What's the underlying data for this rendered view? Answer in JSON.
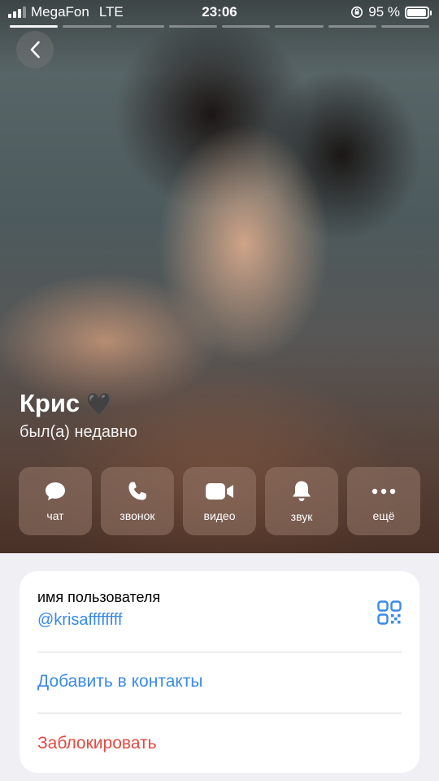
{
  "status_bar": {
    "carrier": "MegaFon",
    "network": "LTE",
    "time": "23:06",
    "battery_text": "95 %",
    "battery_level": 0.95
  },
  "story_progress": {
    "segments": 8,
    "active_index": 0
  },
  "profile": {
    "name": "Крис",
    "name_emoji": "🖤",
    "last_seen": "был(а) недавно"
  },
  "actions": [
    {
      "icon": "chat-bubble-icon",
      "label": "чат"
    },
    {
      "icon": "phone-icon",
      "label": "звонок"
    },
    {
      "icon": "video-camera-icon",
      "label": "видео"
    },
    {
      "icon": "bell-icon",
      "label": "звук"
    },
    {
      "icon": "more-dots-icon",
      "label": "ещё"
    }
  ],
  "info": {
    "username_caption": "имя пользователя",
    "username_value": "@krisaffffffff",
    "add_contact": "Добавить в контакты",
    "block": "Заблокировать"
  },
  "colors": {
    "link_blue": "#3a8ae8",
    "destructive_red": "#e8483e",
    "page_bg": "#efeff4"
  }
}
